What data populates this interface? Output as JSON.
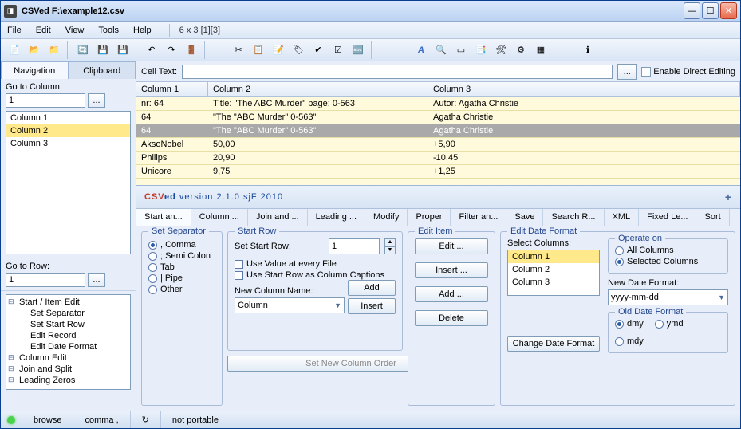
{
  "title": "CSVed F:\\example12.csv",
  "menu": {
    "file": "File",
    "edit": "Edit",
    "view": "View",
    "tools": "Tools",
    "help": "Help",
    "status": "6 x 3 [1][3]"
  },
  "leftpane": {
    "tab_navigation": "Navigation",
    "tab_clipboard": "Clipboard",
    "goto_column": "Go to Column:",
    "goto_column_val": "1",
    "columns": [
      "Column 1",
      "Column 2",
      "Column 3"
    ],
    "selected_col": 1,
    "goto_row": "Go to Row:",
    "goto_row_val": "1",
    "tree_root": "Start / Item Edit",
    "tree_children": [
      "Set Separator",
      "Set Start Row",
      "Edit Record",
      "Edit Date Format"
    ],
    "tree_nodes": [
      "Column Edit",
      "Join and Split",
      "Leading Zeros"
    ]
  },
  "celltext": {
    "label": "Cell Text:",
    "value": "",
    "btn": "...",
    "enable": "Enable Direct Editing"
  },
  "grid": {
    "headers": [
      "Column 1",
      "Column 2",
      "Column 3"
    ],
    "rows": [
      {
        "c1": "nr: 64",
        "c2": "Title: \"The ABC Murder\" page: 0-563",
        "c3": "Autor: Agatha Christie"
      },
      {
        "c1": "64",
        "c2": "\"The \"ABC Murder\" 0-563\"",
        "c3": "Agatha Christie"
      },
      {
        "c1": "64",
        "c2": "\"The \"ABC Murder\" 0-563\"",
        "c3": "Agatha Christie",
        "sel": true
      },
      {
        "c1": "AksoNobel",
        "c2": "50,00",
        "c3": "+5,90"
      },
      {
        "c1": "Philips",
        "c2": "20,90",
        "c3": "-10,45"
      },
      {
        "c1": "Unicore",
        "c2": "9,75",
        "c3": "+1,25"
      }
    ]
  },
  "version": "CSVed version 2.1.0 sjF 2010",
  "lowertabs": [
    "Start an...",
    "Column ...",
    "Join and ...",
    "Leading ...",
    "Modify",
    "Proper",
    "Filter an...",
    "Save",
    "Search R...",
    "XML",
    "Fixed Le...",
    "Sort"
  ],
  "separator": {
    "title": "Set Separator",
    "opts": [
      ", Comma",
      "; Semi Colon",
      "Tab",
      "| Pipe",
      "Other"
    ],
    "sel": 0
  },
  "startrow": {
    "title": "Start Row",
    "label": "Set Start Row:",
    "value": "1",
    "usevalue": "Use Value at every File",
    "usecaption": "Use Start Row as Column Captions",
    "newcol_label": "New Column Name:",
    "newcol_value": "Column",
    "add": "Add",
    "insert": "Insert",
    "setorder": "Set New Column Order"
  },
  "edititem": {
    "title": "Edit Item",
    "edit": "Edit ...",
    "insert": "Insert ...",
    "add": "Add ...",
    "delete": "Delete"
  },
  "dateformat": {
    "title": "Edit Date Format",
    "selcols": "Select Columns:",
    "cols": [
      "Column 1",
      "Column 2",
      "Column 3"
    ],
    "sel": 0,
    "change": "Change Date Format",
    "operate_title": "Operate on",
    "operate": [
      "All Columns",
      "Selected Columns"
    ],
    "operate_sel": 1,
    "newfmt_label": "New Date Format:",
    "newfmt": "yyyy-mm-dd",
    "oldfmt_title": "Old Date Format",
    "oldfmt": [
      "dmy",
      "ymd",
      "mdy"
    ],
    "oldfmt_sel": 0
  },
  "statusbar": {
    "browse": "browse",
    "sep": "comma ,",
    "portable": "not portable"
  }
}
